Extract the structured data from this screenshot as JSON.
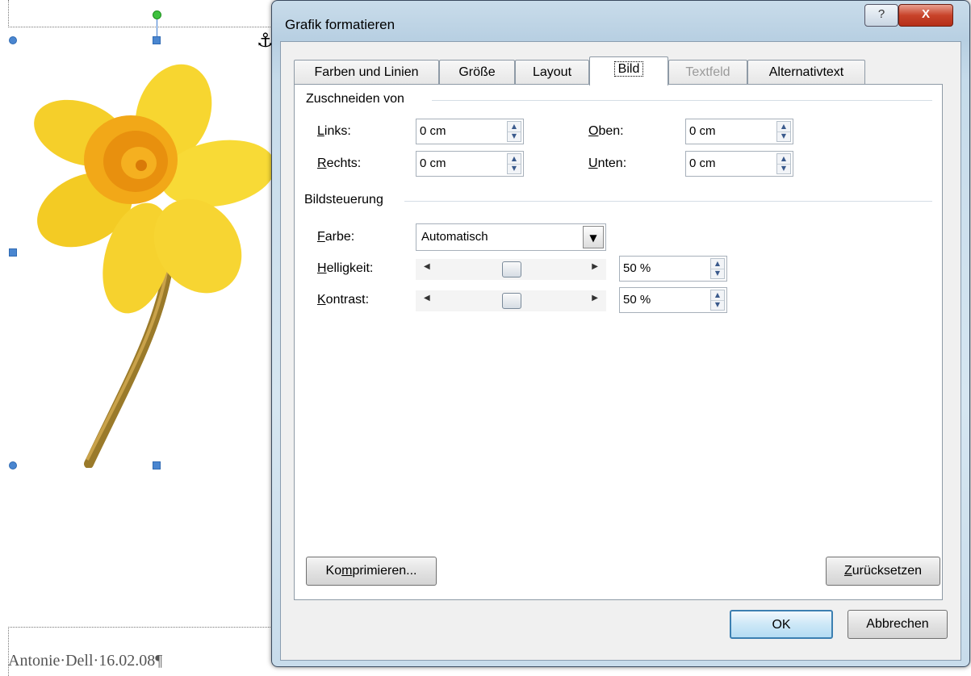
{
  "document": {
    "caption": "Antonie·Dell·16.02.08¶"
  },
  "dialog": {
    "title": "Grafik formatieren",
    "help_label": "?",
    "close_label": "X",
    "tabs": [
      {
        "label": "Farben und Linien",
        "state": "normal"
      },
      {
        "label": "Größe",
        "state": "normal"
      },
      {
        "label": "Layout",
        "state": "normal"
      },
      {
        "label": "Bild",
        "state": "active"
      },
      {
        "label": "Textfeld",
        "state": "disabled"
      },
      {
        "label": "Alternativtext",
        "state": "normal"
      }
    ],
    "crop": {
      "group_label": "Zuschneiden von",
      "links_label": "Links:",
      "links_value": "0 cm",
      "rechts_label": "Rechts:",
      "rechts_value": "0 cm",
      "oben_label": "Oben:",
      "oben_value": "0 cm",
      "unten_label": "Unten:",
      "unten_value": "0 cm"
    },
    "image_control": {
      "group_label": "Bildsteuerung",
      "farbe_label": "Farbe:",
      "farbe_value": "Automatisch",
      "helligkeit_label": "Helligkeit:",
      "helligkeit_value": "50 %",
      "helligkeit_level": 0.5,
      "kontrast_label": "Kontrast:",
      "kontrast_value": "50 %",
      "kontrast_level": 0.5
    },
    "compress_label": "Komprimieren...",
    "reset_label": "Zurücksetzen",
    "ok_label": "OK",
    "cancel_label": "Abbrechen"
  }
}
